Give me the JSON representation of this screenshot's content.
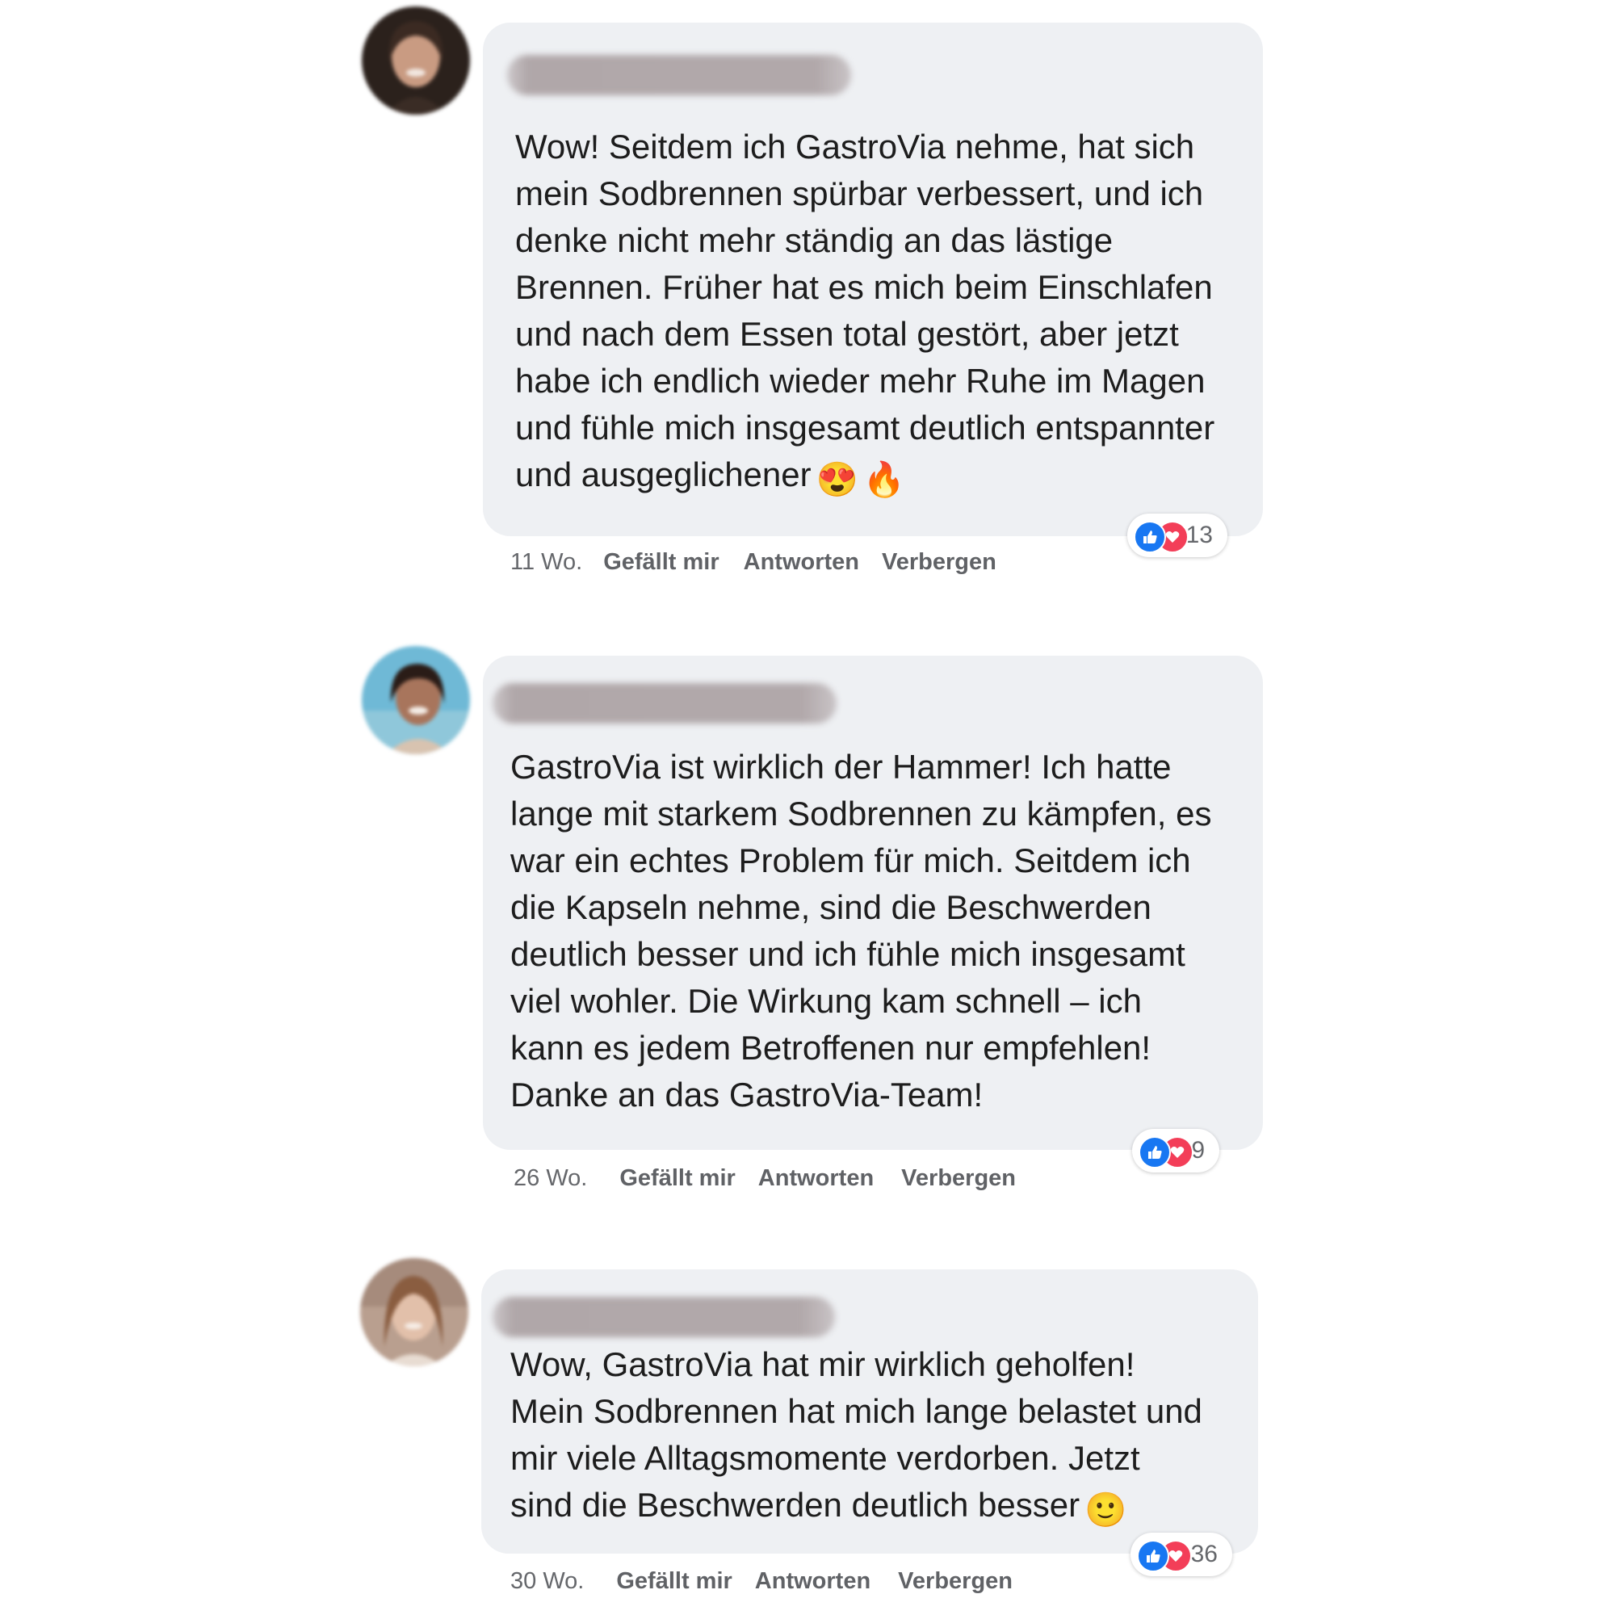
{
  "comments": [
    {
      "text": "Wow! Seitdem ich GastroVia nehme, hat sich\nmein Sodbrennen spürbar verbessert, und ich\ndenke nicht mehr ständig an das lästige\nBrennen. Früher hat es mich beim Einschlafen\nund nach dem Essen total gestört, aber jetzt\nhabe ich endlich wieder mehr Ruhe im Magen\nund fühle mich insgesamt deutlich entspannter\nund ausgeglichener",
      "emojis": [
        "😍",
        "🔥"
      ],
      "reaction_count": "13",
      "time": "11 Wo.",
      "like_label": "Gefällt mir",
      "reply_label": "Antworten",
      "hide_label": "Verbergen"
    },
    {
      "text": "GastroVia ist wirklich der Hammer! Ich hatte\nlange mit starkem Sodbrennen zu kämpfen, es\nwar ein echtes Problem für mich. Seitdem ich\ndie Kapseln nehme, sind die Beschwerden\ndeutlich besser und ich fühle mich insgesamt\nviel wohler. Die Wirkung kam schnell – ich\nkann es jedem Betroffenen nur empfehlen!\nDanke an das GastroVia-Team!",
      "emojis": [],
      "reaction_count": "9",
      "time": "26 Wo.",
      "like_label": "Gefällt mir",
      "reply_label": "Antworten",
      "hide_label": "Verbergen"
    },
    {
      "text": "Wow, GastroVia hat mir wirklich geholfen!\nMein Sodbrennen hat mich lange belastet und\nmir viele Alltagsmomente verdorben. Jetzt\nsind die Beschwerden deutlich besser",
      "emojis": [
        "🙂"
      ],
      "reaction_count": "36",
      "time": "30 Wo.",
      "like_label": "Gefällt mir",
      "reply_label": "Antworten",
      "hide_label": "Verbergen"
    }
  ],
  "colors": {
    "bubble": "#eef0f3",
    "like_blue": "#1877f2",
    "love_red": "#f33e58",
    "meta_gray": "#65676b"
  },
  "icons": {
    "like": "thumbs-up-icon",
    "love": "heart-icon"
  }
}
